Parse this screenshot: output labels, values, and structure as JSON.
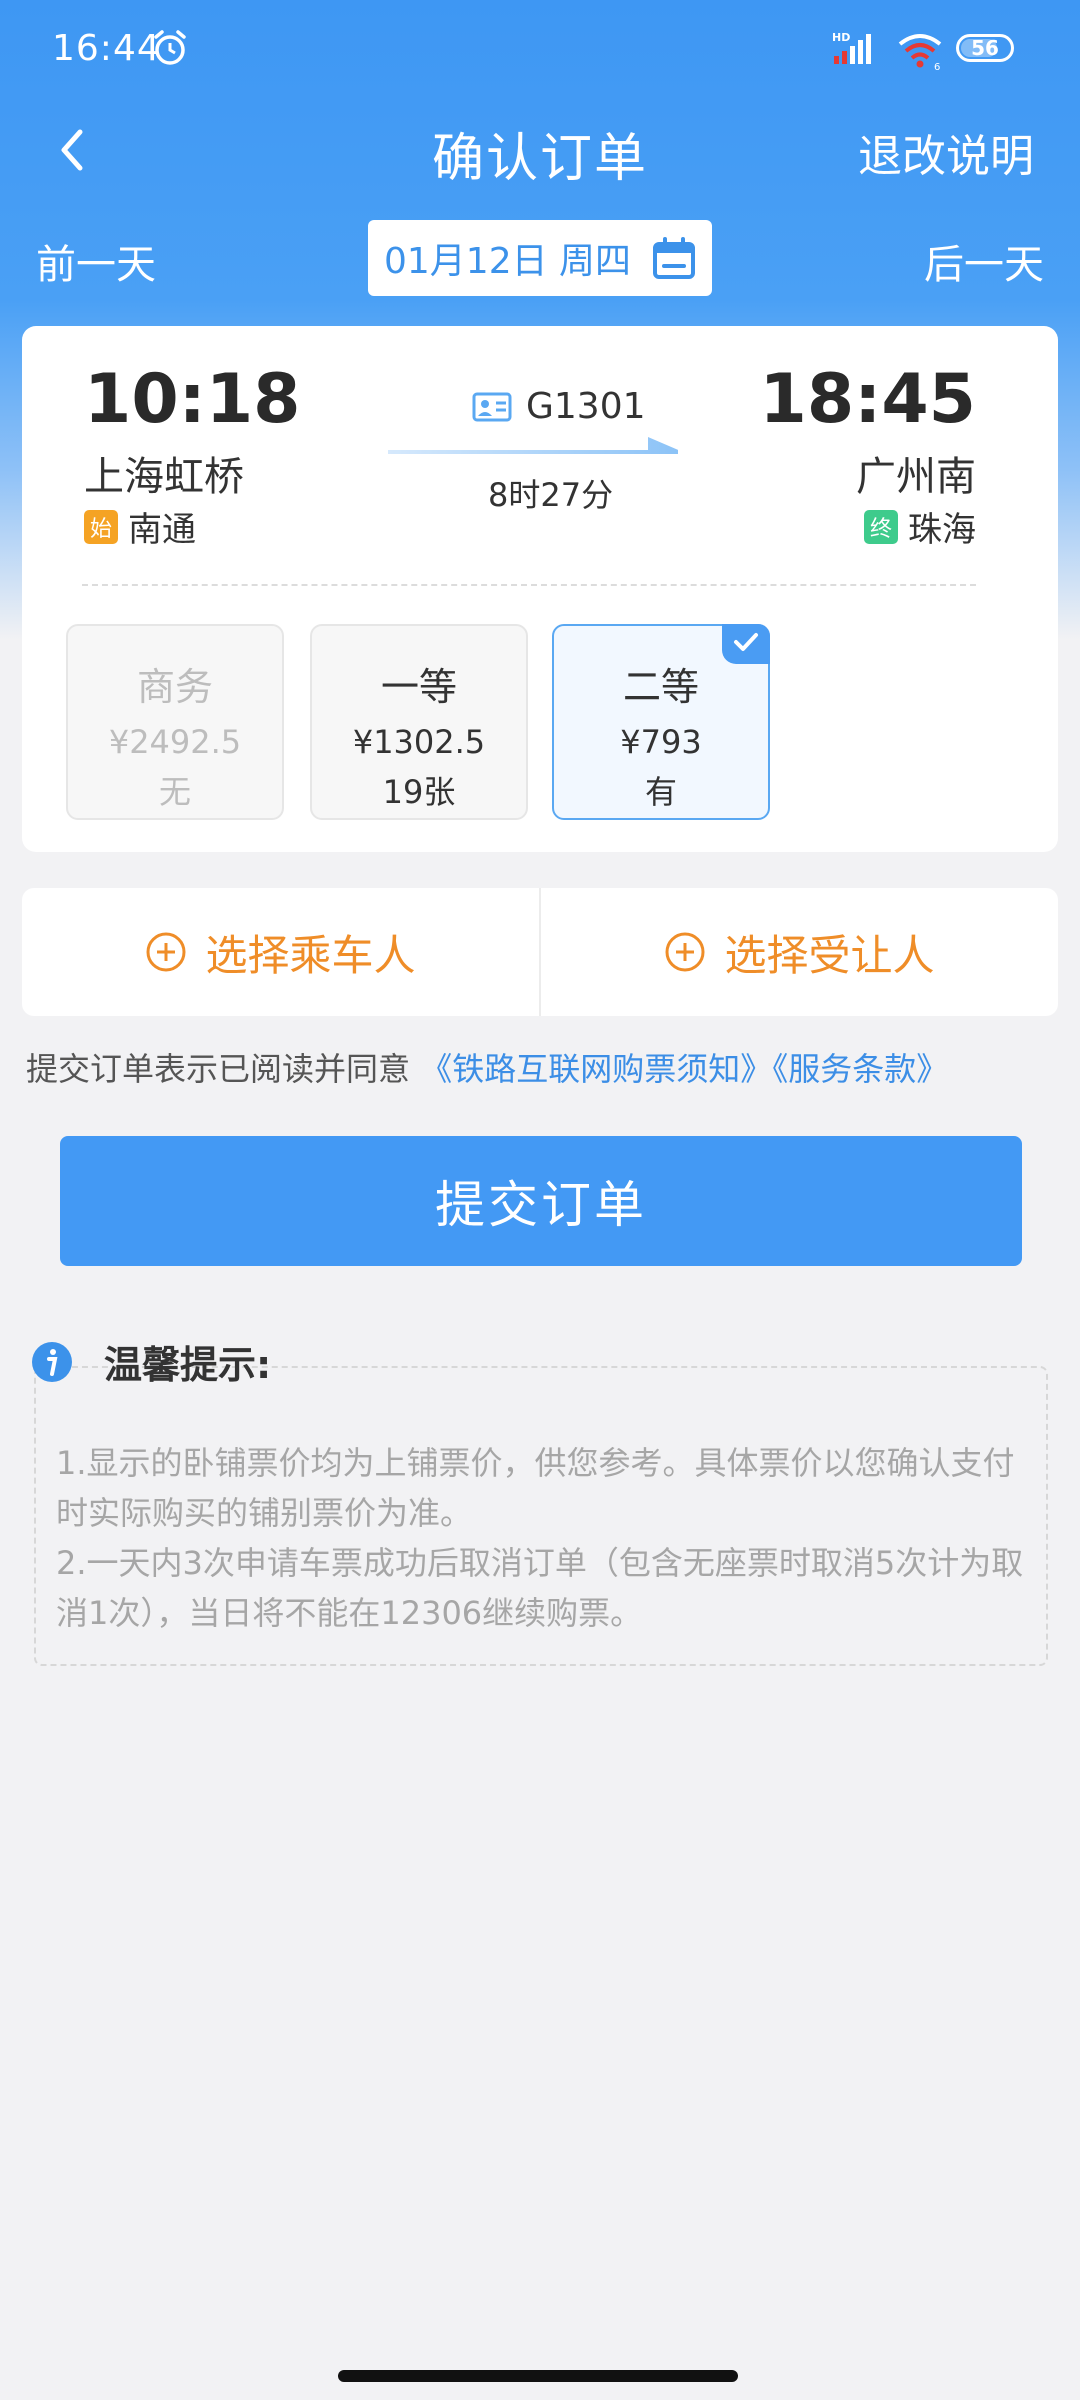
{
  "status_bar": {
    "time": "16:44",
    "battery": "56",
    "icons": [
      "alarm-icon",
      "signal-icon",
      "wifi-icon",
      "battery-icon"
    ]
  },
  "nav": {
    "title": "确认订单",
    "action": "退改说明"
  },
  "date_bar": {
    "prev": "前一天",
    "next": "后一天",
    "date": "01月12日 周四"
  },
  "train": {
    "departure_time": "10:18",
    "departure_station": "上海虹桥",
    "origin_tag": "始",
    "origin_station": "南通",
    "arrival_time": "18:45",
    "arrival_station": "广州南",
    "terminal_tag": "终",
    "terminal_station": "珠海",
    "train_number": "G1301",
    "duration": "8时27分"
  },
  "seats": [
    {
      "name": "商务",
      "price": "¥2492.5",
      "availability": "无",
      "state": "disabled"
    },
    {
      "name": "一等",
      "price": "¥1302.5",
      "availability": "19张",
      "state": "normal"
    },
    {
      "name": "二等",
      "price": "¥793",
      "availability": "有",
      "state": "selected"
    }
  ],
  "passenger": {
    "select_passenger": "选择乘车人",
    "select_transferee": "选择受让人"
  },
  "agreement": {
    "prefix": "提交订单表示已阅读并同意",
    "link1": "《铁路互联网购票须知》",
    "link2": "《服务条款》"
  },
  "submit_label": "提交订单",
  "tips": {
    "title": "温馨提示:",
    "line1": "1.显示的卧铺票价均为上铺票价，供您参考。具体票价以您确认支付时实际购买的铺别票价为准。",
    "line2": "2.一天内3次申请车票成功后取消订单（包含无座票时取消5次计为取消1次），当日将不能在12306继续购票。"
  },
  "colors": {
    "primary": "#4399f4",
    "accent_orange": "#ef8d28",
    "link": "#3c8ee6",
    "tag_start": "#f5a324",
    "tag_end": "#3ecb8c"
  }
}
